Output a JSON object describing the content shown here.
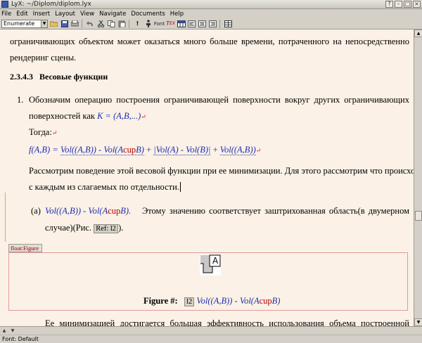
{
  "window": {
    "title": "LyX: ~/Diplom/diplom.lyx",
    "buttons": [
      "?",
      "–",
      "□",
      "×"
    ]
  },
  "menu": [
    "File",
    "Edit",
    "Insert",
    "Layout",
    "View",
    "Navigate",
    "Documents",
    "Help"
  ],
  "toolbar": {
    "layout_value": "Enumerate",
    "font_label": "Font"
  },
  "doc": {
    "line1": "ограничивающих объектом может оказаться много больше времени, потраченного на непосредственно",
    "line2": "рендеринг сцены.",
    "heading_num": "2.3.4.3",
    "heading_text": "Весовые функции",
    "item_num": "1.",
    "item1_line1": "Обозначим операцию построения ограничивающей поверхности вокруг других ограничивающих",
    "item1_line2_prefix": "поверхностей как",
    "item1_math": "K = (A,B,...)",
    "togda": "Тогда:",
    "formula_f": "f(A,B) =",
    "formula_t1": "Vol((A,B)) - Vol(A",
    "formula_cup": "cup",
    "formula_B": "B)",
    "formula_plus1": "+",
    "formula_t2": "|Vol(A) - Vol(B)|",
    "formula_plus2": "+",
    "formula_t3": "Vol((A,B))",
    "para2_line1": "Рассмотрим поведение этой весовой функции при ее минимизации. Для этого рассмотрим что происходит",
    "para2_line2": "с каждым из слагаемых по отдельности.",
    "sub_a": "(a)",
    "sub_a_math": "Vol((A,B)) - Vol(A",
    "sub_a_cup": "cup",
    "sub_a_B": "B).",
    "sub_a_text": "Этому значению соответствует заштрихованная область(в двумерном",
    "sub_a_line2": "случае)(Рис.",
    "ref_label": "Ref: l2",
    "sub_a_end": ").",
    "float_label": "float:Figure",
    "fig_letter": "A",
    "fig_caption": "Figure #:",
    "fig_label": "l2",
    "fig_math": "Vol((A,B)) - Vol(A",
    "fig_cup": "cup",
    "fig_B": "B)",
    "last_line": "Ее минимизацией достигается большая эффективность использования объема построенной"
  },
  "status": "Font: Default"
}
